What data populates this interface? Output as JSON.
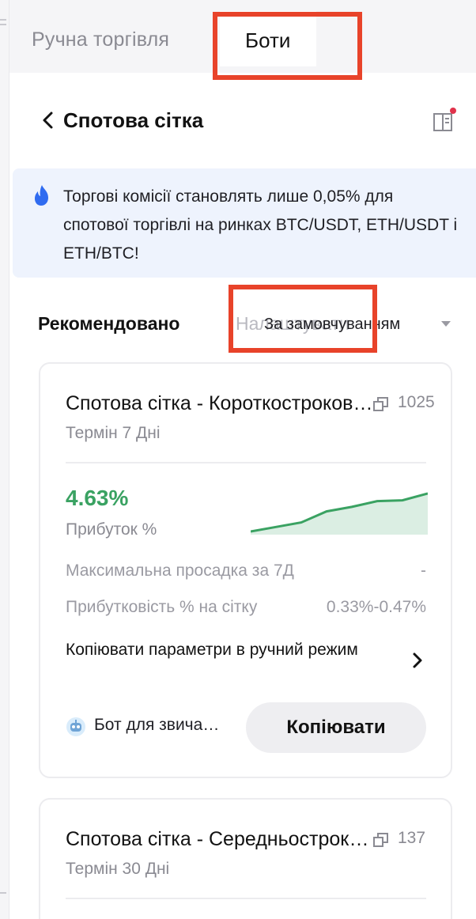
{
  "tabs": {
    "manual": "Ручна торгівля",
    "bots": "Боти"
  },
  "header": {
    "title": "Спотова сітка",
    "back_icon": "chevron-left-icon",
    "guide_icon": "book-icon"
  },
  "banner": {
    "icon": "fire-icon",
    "text": "Торгові комісії становлять лише 0,05% для спотової торгівлі на ринках BTC/USDT, ETH/USDT і ETH/BTC!"
  },
  "filter": {
    "recommended": "Рекомендовано",
    "ghost_text": "Налаштувати",
    "sort": "За замовчуванням"
  },
  "cards": [
    {
      "title": "Спотова сітка - Короткостроковий",
      "copies": "1025",
      "term": "Термін 7 Дні",
      "pnl": "4.63%",
      "pnl_label": "Прибуток %",
      "max_drawdown_label": "Максимальна просадка за 7Д",
      "max_drawdown_value": "-",
      "grid_profit_label": "Прибутковість % на сітку",
      "grid_profit_value": "0.33%-0.47%",
      "copy_params": "Копіювати параметри в ручний режим",
      "bot_name": "Бот для звичайних користувачів",
      "copy_button": "Копіювати",
      "sparkline": [
        0.0,
        0.55,
        1.1,
        2.45,
        3.0,
        3.7,
        3.8,
        4.63
      ],
      "accent_color": "#3aa262"
    },
    {
      "title": "Спотова сітка - Середньостроковий",
      "copies": "137",
      "term": "Термін 30 Дні"
    }
  ]
}
